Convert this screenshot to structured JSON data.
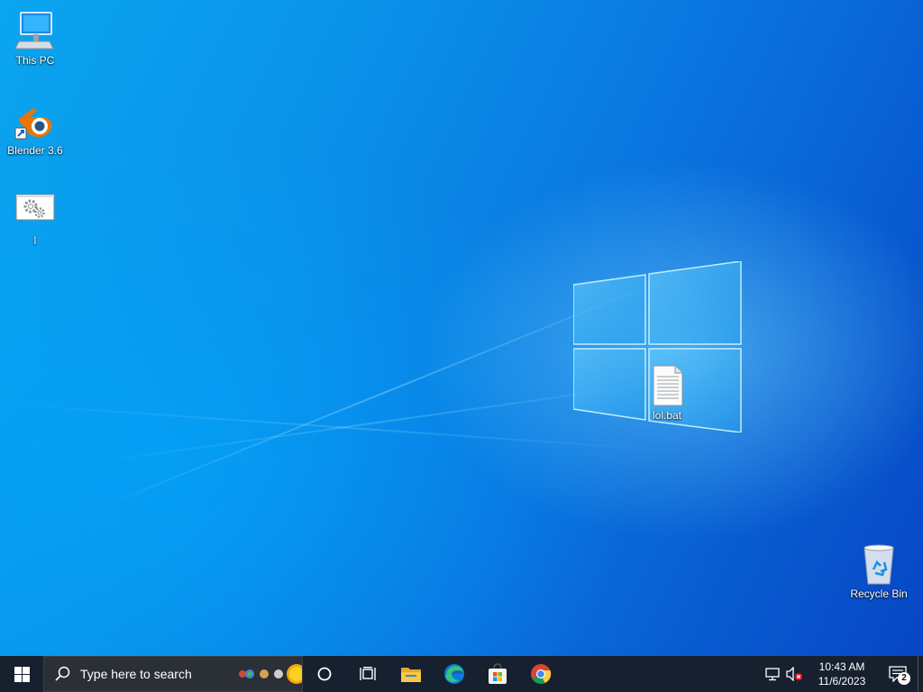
{
  "desktop": {
    "icons": [
      {
        "label": "This PC",
        "icon": "computer-icon"
      },
      {
        "label": "Blender 3.6",
        "icon": "blender-icon"
      },
      {
        "label": "l",
        "icon": "settings-gears-icon"
      },
      {
        "label": "lol.bat",
        "icon": "text-file-icon"
      },
      {
        "label": "Recycle Bin",
        "icon": "recycle-bin-icon"
      }
    ]
  },
  "taskbar": {
    "start_icon": "windows-start-icon",
    "search": {
      "placeholder": "Type here to search",
      "icon": "search-icon"
    },
    "pinned": [
      {
        "name": "cortana",
        "icon": "cortana-circle-icon"
      },
      {
        "name": "task-view",
        "icon": "task-view-icon"
      },
      {
        "name": "file-explorer",
        "icon": "folder-icon"
      },
      {
        "name": "edge",
        "icon": "edge-icon"
      },
      {
        "name": "store",
        "icon": "store-icon"
      },
      {
        "name": "chrome",
        "icon": "chrome-icon"
      }
    ],
    "tray": {
      "network_icon": "network-icon",
      "volume_icon": "volume-muted-icon",
      "time": "10:43 AM",
      "date": "11/6/2023",
      "notifications_count": "2"
    }
  },
  "colors": {
    "taskbar_bg": "#16202e",
    "desktop_accent": "#0a8ee8"
  }
}
